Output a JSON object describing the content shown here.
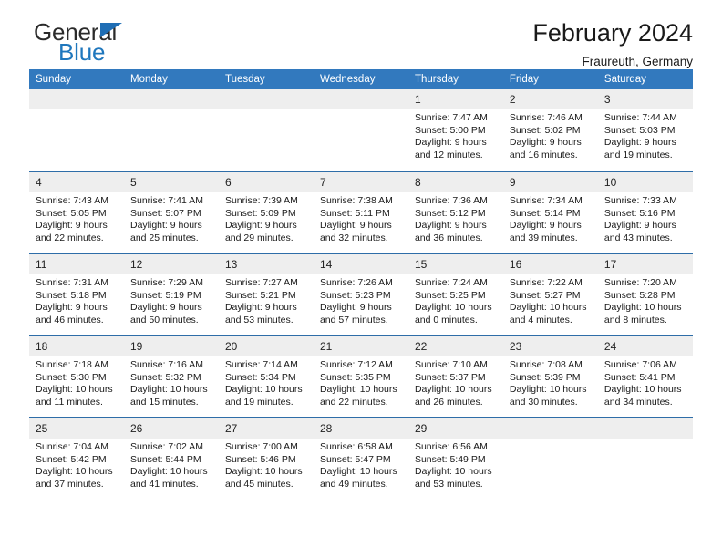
{
  "brand": {
    "word_general": "General",
    "word_blue": "Blue",
    "triangle_icon": "brand-triangle-icon",
    "accent_color": "#1f77bd"
  },
  "header": {
    "title": "February 2024",
    "subtitle": "Fraureuth, Germany"
  },
  "theme": {
    "header_blue": "#3279be",
    "row_rule_blue": "#2e6da8",
    "daynum_band": "#eeeeee",
    "cell_bg": "#ffffff",
    "text": "#1a1a1a"
  },
  "calendar": {
    "weekday_headers": [
      "Sunday",
      "Monday",
      "Tuesday",
      "Wednesday",
      "Thursday",
      "Friday",
      "Saturday"
    ],
    "weeks": [
      [
        {
          "day": "",
          "empty": true,
          "sunrise": "",
          "sunset": "",
          "daylight_line1": "",
          "daylight_line2": ""
        },
        {
          "day": "",
          "empty": true,
          "sunrise": "",
          "sunset": "",
          "daylight_line1": "",
          "daylight_line2": ""
        },
        {
          "day": "",
          "empty": true,
          "sunrise": "",
          "sunset": "",
          "daylight_line1": "",
          "daylight_line2": ""
        },
        {
          "day": "",
          "empty": true,
          "sunrise": "",
          "sunset": "",
          "daylight_line1": "",
          "daylight_line2": ""
        },
        {
          "day": "1",
          "empty": false,
          "sunrise": "Sunrise: 7:47 AM",
          "sunset": "Sunset: 5:00 PM",
          "daylight_line1": "Daylight: 9 hours",
          "daylight_line2": "and 12 minutes."
        },
        {
          "day": "2",
          "empty": false,
          "sunrise": "Sunrise: 7:46 AM",
          "sunset": "Sunset: 5:02 PM",
          "daylight_line1": "Daylight: 9 hours",
          "daylight_line2": "and 16 minutes."
        },
        {
          "day": "3",
          "empty": false,
          "sunrise": "Sunrise: 7:44 AM",
          "sunset": "Sunset: 5:03 PM",
          "daylight_line1": "Daylight: 9 hours",
          "daylight_line2": "and 19 minutes."
        }
      ],
      [
        {
          "day": "4",
          "empty": false,
          "sunrise": "Sunrise: 7:43 AM",
          "sunset": "Sunset: 5:05 PM",
          "daylight_line1": "Daylight: 9 hours",
          "daylight_line2": "and 22 minutes."
        },
        {
          "day": "5",
          "empty": false,
          "sunrise": "Sunrise: 7:41 AM",
          "sunset": "Sunset: 5:07 PM",
          "daylight_line1": "Daylight: 9 hours",
          "daylight_line2": "and 25 minutes."
        },
        {
          "day": "6",
          "empty": false,
          "sunrise": "Sunrise: 7:39 AM",
          "sunset": "Sunset: 5:09 PM",
          "daylight_line1": "Daylight: 9 hours",
          "daylight_line2": "and 29 minutes."
        },
        {
          "day": "7",
          "empty": false,
          "sunrise": "Sunrise: 7:38 AM",
          "sunset": "Sunset: 5:11 PM",
          "daylight_line1": "Daylight: 9 hours",
          "daylight_line2": "and 32 minutes."
        },
        {
          "day": "8",
          "empty": false,
          "sunrise": "Sunrise: 7:36 AM",
          "sunset": "Sunset: 5:12 PM",
          "daylight_line1": "Daylight: 9 hours",
          "daylight_line2": "and 36 minutes."
        },
        {
          "day": "9",
          "empty": false,
          "sunrise": "Sunrise: 7:34 AM",
          "sunset": "Sunset: 5:14 PM",
          "daylight_line1": "Daylight: 9 hours",
          "daylight_line2": "and 39 minutes."
        },
        {
          "day": "10",
          "empty": false,
          "sunrise": "Sunrise: 7:33 AM",
          "sunset": "Sunset: 5:16 PM",
          "daylight_line1": "Daylight: 9 hours",
          "daylight_line2": "and 43 minutes."
        }
      ],
      [
        {
          "day": "11",
          "empty": false,
          "sunrise": "Sunrise: 7:31 AM",
          "sunset": "Sunset: 5:18 PM",
          "daylight_line1": "Daylight: 9 hours",
          "daylight_line2": "and 46 minutes."
        },
        {
          "day": "12",
          "empty": false,
          "sunrise": "Sunrise: 7:29 AM",
          "sunset": "Sunset: 5:19 PM",
          "daylight_line1": "Daylight: 9 hours",
          "daylight_line2": "and 50 minutes."
        },
        {
          "day": "13",
          "empty": false,
          "sunrise": "Sunrise: 7:27 AM",
          "sunset": "Sunset: 5:21 PM",
          "daylight_line1": "Daylight: 9 hours",
          "daylight_line2": "and 53 minutes."
        },
        {
          "day": "14",
          "empty": false,
          "sunrise": "Sunrise: 7:26 AM",
          "sunset": "Sunset: 5:23 PM",
          "daylight_line1": "Daylight: 9 hours",
          "daylight_line2": "and 57 minutes."
        },
        {
          "day": "15",
          "empty": false,
          "sunrise": "Sunrise: 7:24 AM",
          "sunset": "Sunset: 5:25 PM",
          "daylight_line1": "Daylight: 10 hours",
          "daylight_line2": "and 0 minutes."
        },
        {
          "day": "16",
          "empty": false,
          "sunrise": "Sunrise: 7:22 AM",
          "sunset": "Sunset: 5:27 PM",
          "daylight_line1": "Daylight: 10 hours",
          "daylight_line2": "and 4 minutes."
        },
        {
          "day": "17",
          "empty": false,
          "sunrise": "Sunrise: 7:20 AM",
          "sunset": "Sunset: 5:28 PM",
          "daylight_line1": "Daylight: 10 hours",
          "daylight_line2": "and 8 minutes."
        }
      ],
      [
        {
          "day": "18",
          "empty": false,
          "sunrise": "Sunrise: 7:18 AM",
          "sunset": "Sunset: 5:30 PM",
          "daylight_line1": "Daylight: 10 hours",
          "daylight_line2": "and 11 minutes."
        },
        {
          "day": "19",
          "empty": false,
          "sunrise": "Sunrise: 7:16 AM",
          "sunset": "Sunset: 5:32 PM",
          "daylight_line1": "Daylight: 10 hours",
          "daylight_line2": "and 15 minutes."
        },
        {
          "day": "20",
          "empty": false,
          "sunrise": "Sunrise: 7:14 AM",
          "sunset": "Sunset: 5:34 PM",
          "daylight_line1": "Daylight: 10 hours",
          "daylight_line2": "and 19 minutes."
        },
        {
          "day": "21",
          "empty": false,
          "sunrise": "Sunrise: 7:12 AM",
          "sunset": "Sunset: 5:35 PM",
          "daylight_line1": "Daylight: 10 hours",
          "daylight_line2": "and 22 minutes."
        },
        {
          "day": "22",
          "empty": false,
          "sunrise": "Sunrise: 7:10 AM",
          "sunset": "Sunset: 5:37 PM",
          "daylight_line1": "Daylight: 10 hours",
          "daylight_line2": "and 26 minutes."
        },
        {
          "day": "23",
          "empty": false,
          "sunrise": "Sunrise: 7:08 AM",
          "sunset": "Sunset: 5:39 PM",
          "daylight_line1": "Daylight: 10 hours",
          "daylight_line2": "and 30 minutes."
        },
        {
          "day": "24",
          "empty": false,
          "sunrise": "Sunrise: 7:06 AM",
          "sunset": "Sunset: 5:41 PM",
          "daylight_line1": "Daylight: 10 hours",
          "daylight_line2": "and 34 minutes."
        }
      ],
      [
        {
          "day": "25",
          "empty": false,
          "sunrise": "Sunrise: 7:04 AM",
          "sunset": "Sunset: 5:42 PM",
          "daylight_line1": "Daylight: 10 hours",
          "daylight_line2": "and 37 minutes."
        },
        {
          "day": "26",
          "empty": false,
          "sunrise": "Sunrise: 7:02 AM",
          "sunset": "Sunset: 5:44 PM",
          "daylight_line1": "Daylight: 10 hours",
          "daylight_line2": "and 41 minutes."
        },
        {
          "day": "27",
          "empty": false,
          "sunrise": "Sunrise: 7:00 AM",
          "sunset": "Sunset: 5:46 PM",
          "daylight_line1": "Daylight: 10 hours",
          "daylight_line2": "and 45 minutes."
        },
        {
          "day": "28",
          "empty": false,
          "sunrise": "Sunrise: 6:58 AM",
          "sunset": "Sunset: 5:47 PM",
          "daylight_line1": "Daylight: 10 hours",
          "daylight_line2": "and 49 minutes."
        },
        {
          "day": "29",
          "empty": false,
          "sunrise": "Sunrise: 6:56 AM",
          "sunset": "Sunset: 5:49 PM",
          "daylight_line1": "Daylight: 10 hours",
          "daylight_line2": "and 53 minutes."
        },
        {
          "day": "",
          "empty": true,
          "sunrise": "",
          "sunset": "",
          "daylight_line1": "",
          "daylight_line2": ""
        },
        {
          "day": "",
          "empty": true,
          "sunrise": "",
          "sunset": "",
          "daylight_line1": "",
          "daylight_line2": ""
        }
      ]
    ]
  }
}
